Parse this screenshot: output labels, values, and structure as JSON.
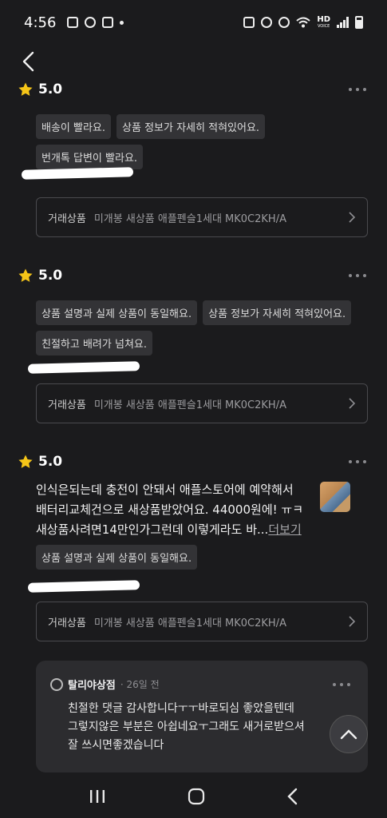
{
  "status_bar": {
    "time": "4:56",
    "hd_label": "HD",
    "hd_sub": "VOICE"
  },
  "reviews": [
    {
      "rating": "5.0",
      "tags": [
        "배송이 빨라요.",
        "상품 정보가 자세히 적혀있어요.",
        "번개톡 답변이 빨라요."
      ],
      "product_label": "거래상품",
      "product_name": "미개봉 새상품 애플펜슬1세대 MK0C2KH/A"
    },
    {
      "rating": "5.0",
      "tags": [
        "상품 설명과 실제 상품이 동일해요.",
        "상품 정보가 자세히 적혀있어요.",
        "친절하고 배려가 넘쳐요."
      ],
      "product_label": "거래상품",
      "product_name": "미개봉 새상품 애플펜슬1세대 MK0C2KH/A"
    },
    {
      "rating": "5.0",
      "text_line1": "인식은되는데 충전이 안돼서 애플스토어에 예약해서",
      "text_line2": "배터리교체건으로 새상품받았어요. 44000원에! ㅠㅋ",
      "text_line3": "새상품사려면14만인가그런데 이렇게라도 바...",
      "more": "더보기",
      "tags": [
        "상품 설명과 실제 상품이 동일해요."
      ],
      "product_label": "거래상품",
      "product_name": "미개봉 새상품 애플펜슬1세대 MK0C2KH/A"
    }
  ],
  "reply": {
    "shop_name": "탈리야상점",
    "time": "· 26일 전",
    "text": "친절한 댓글 감사합니다ㅜㅜ바로되심 좋았을텐데\n그렇지않은 부분은 아쉽네요ㅜ그래도 새거로받으셔\n잘 쓰시면좋겠습니다"
  },
  "colors": {
    "background": "#1b1b1d",
    "star": "#f5c518",
    "tag_bg": "#333336"
  }
}
